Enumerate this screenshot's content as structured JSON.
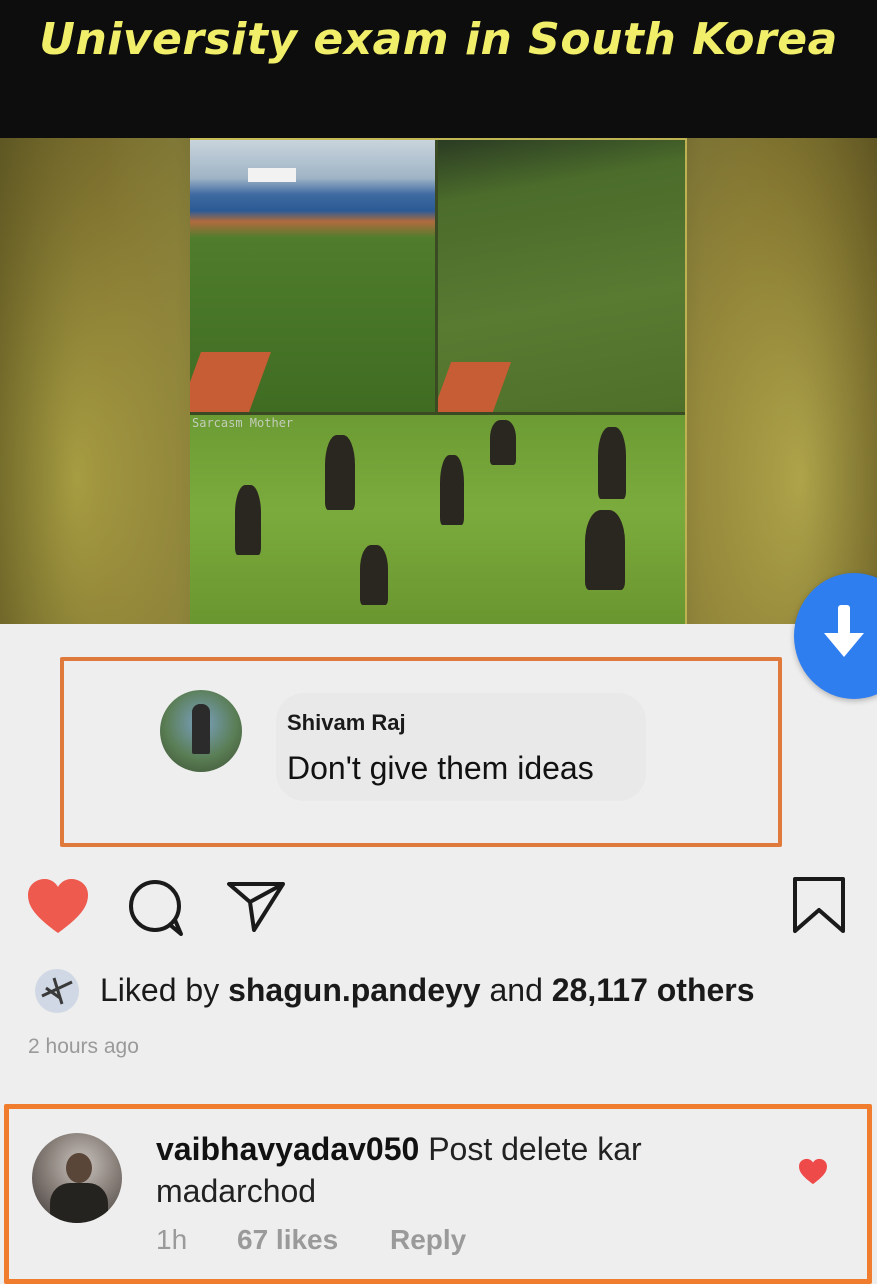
{
  "header": {
    "title": "University exam in South Korea"
  },
  "media": {
    "watermark": "Sarcasm Mother"
  },
  "featured_comment": {
    "author": "Shivam Raj",
    "text": "Don't give them ideas"
  },
  "post": {
    "liked_prefix": "Liked by",
    "liked_user": "shagun.pandeyy",
    "liked_middle": "and",
    "liked_others": "28,117 others",
    "time_ago": "2 hours ago"
  },
  "reply": {
    "username": "vaibhavyadav050",
    "text": "Post delete kar madarchod",
    "time": "1h",
    "likes": "67 likes",
    "reply_label": "Reply"
  },
  "colors": {
    "heart": "#ee5a4e",
    "highlight_border": "#f07d2e",
    "title": "#f1ee6a",
    "download": "#2f7ef0"
  },
  "icons": [
    "heart-icon",
    "comment-icon",
    "share-icon",
    "bookmark-icon",
    "download-icon",
    "small-heart-icon"
  ]
}
